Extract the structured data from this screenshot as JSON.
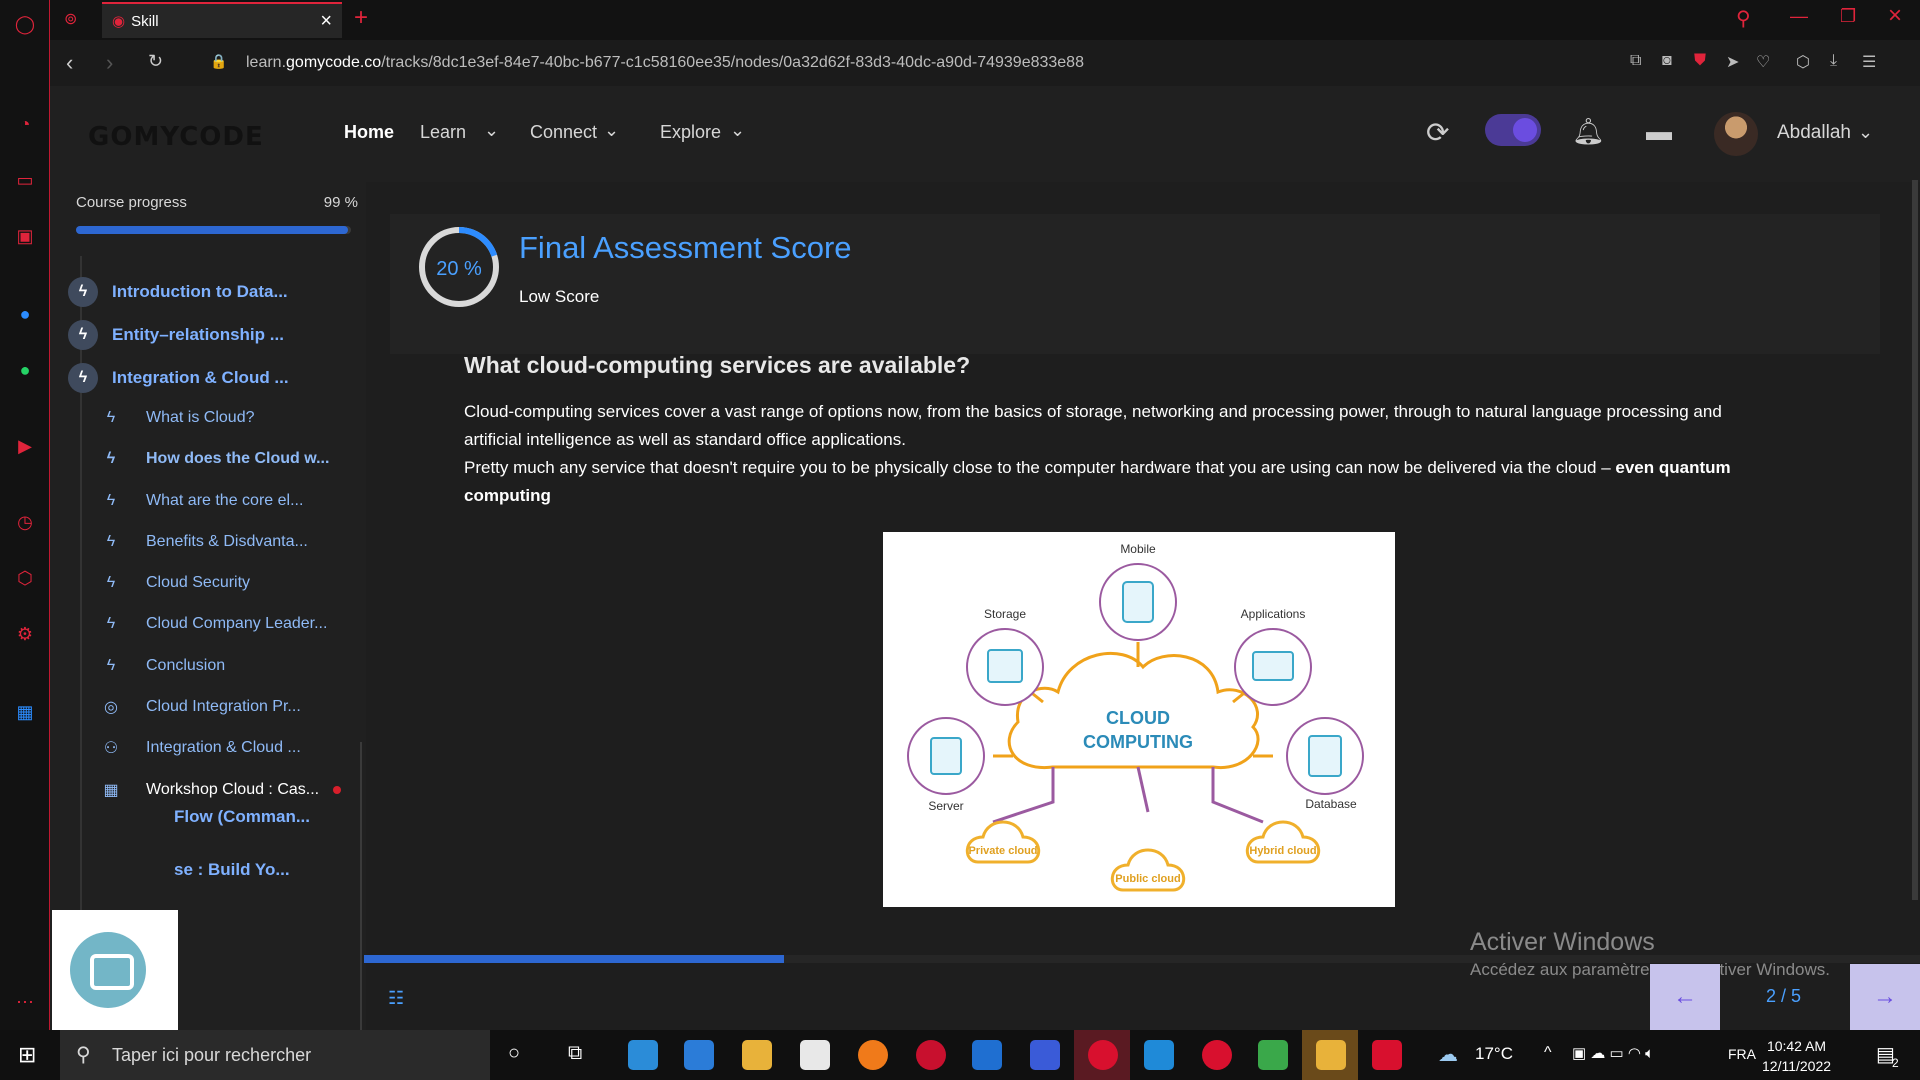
{
  "browser": {
    "tab_title": "Skill",
    "url_prefix": "learn.",
    "url_domain": "gomycode.co",
    "url_path": "/tracks/8dc1e3ef-84e7-40bc-b677-c1c58160ee35/nodes/0a32d62f-83d3-40dc-a90d-74939e833e88"
  },
  "header": {
    "logo": "GOMYCODE",
    "nav": [
      "Home",
      "Learn",
      "Connect",
      "Explore"
    ],
    "username": "Abdallah"
  },
  "sidebar": {
    "progress_label": "Course progress",
    "progress_pct": "99 %",
    "progress_value": 0.99,
    "sections": [
      "Introduction to Data...",
      "Entity–relationship ...",
      "Integration & Cloud ..."
    ],
    "items": [
      {
        "label": "What is Cloud?",
        "icon": "bolt-icon"
      },
      {
        "label": "How does the Cloud w...",
        "icon": "bolt-icon"
      },
      {
        "label": "What are the core el...",
        "icon": "bolt-icon"
      },
      {
        "label": "Benefits & Disdvanta...",
        "icon": "bolt-icon"
      },
      {
        "label": "Cloud Security",
        "icon": "bolt-icon"
      },
      {
        "label": "Cloud Company Leader...",
        "icon": "bolt-icon"
      },
      {
        "label": "Conclusion",
        "icon": "bolt-icon"
      },
      {
        "label": "Cloud Integration Pr...",
        "icon": "target-icon"
      },
      {
        "label": "Integration & Cloud ...",
        "icon": "people-icon"
      },
      {
        "label": "Workshop Cloud : Cas...",
        "icon": "grid-icon"
      },
      {
        "label": "Flow (Comman...",
        "icon": "bolt-icon"
      },
      {
        "label": "se : Build Yo...",
        "icon": "bolt-icon"
      }
    ]
  },
  "score": {
    "percent": "20 %",
    "value": 0.2,
    "title": "Final Assessment Score",
    "subtitle": "Low Score"
  },
  "content": {
    "question": "What cloud-computing services are available?",
    "p1": "Cloud-computing services cover a vast range of options now, from the basics of storage, networking and processing power, through to natural language processing and artificial intelligence as well as standard office applications.",
    "p2_plain": "Pretty much any service that doesn't require you to be physically close to the computer hardware that you are using can now be delivered via the cloud – ",
    "p2_bold": "even quantum computing"
  },
  "figure": {
    "center_line1": "CLOUD",
    "center_line2": "COMPUTING",
    "labels": [
      "Mobile",
      "Storage",
      "Applications",
      "Server",
      "Database"
    ],
    "clouds": [
      "Private cloud",
      "Public cloud",
      "Hybrid cloud"
    ]
  },
  "footer": {
    "slider_value": 0.27,
    "pager": "2 / 5",
    "watermark_title": "Activer Windows",
    "watermark_sub": "Accédez aux paramètres pour activer Windows."
  },
  "taskbar": {
    "search_placeholder": "Taper ici pour rechercher",
    "weather": "17°C",
    "lang": "FRA",
    "time": "10:42 AM",
    "date": "12/11/2022",
    "notifications": "2"
  }
}
